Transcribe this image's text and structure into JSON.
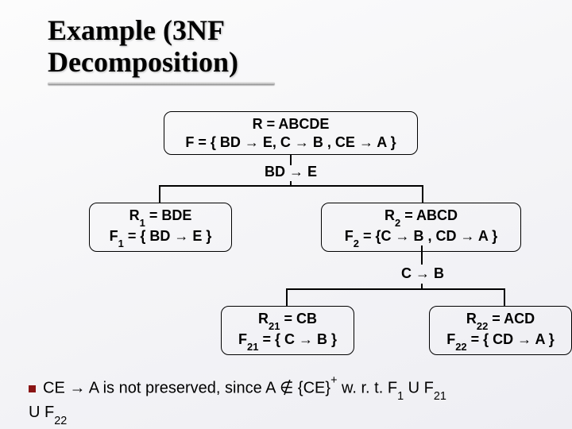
{
  "title": {
    "line1": "Example (3NF",
    "line2": "Decomposition)"
  },
  "root": {
    "line1": "R = ABCDE",
    "line2_pre": "F = { BD ",
    "line2_mid1": " E, C ",
    "line2_mid2": " B , CE ",
    "line2_post": " A }"
  },
  "edge1": {
    "pre": "BD ",
    "post": " E"
  },
  "r1": {
    "line1_html": "R<sub>1</sub> = BDE",
    "line2_pre_html": "F<sub>1</sub> = { BD ",
    "line2_post": " E }"
  },
  "r2": {
    "line1_html": "R<sub>2</sub> = ABCD",
    "line2_pre_html": "F<sub>2</sub> = {C ",
    "line2_mid": " B , CD ",
    "line2_post": " A }"
  },
  "edge2": {
    "pre": "C ",
    "post": " B"
  },
  "r21": {
    "line1_html": "R<sub>21</sub> = CB",
    "line2_pre_html": "F<sub>21</sub> = { C ",
    "line2_post": " B }"
  },
  "r22": {
    "line1_html": "R<sub>22</sub> = ACD",
    "line2_pre_html": "F<sub>22</sub> = { CD ",
    "line2_post": " A }"
  },
  "note": {
    "ce": "CE ",
    "a1": " A",
    "mid1": " is not preserved, since ",
    "a2": "A ",
    "notin": "∉",
    "ceplus": " {CE}",
    "wrt": "  w. r. t.  ",
    "f1": "F",
    "u": " U ",
    "f21": "F",
    "f22": "F"
  }
}
